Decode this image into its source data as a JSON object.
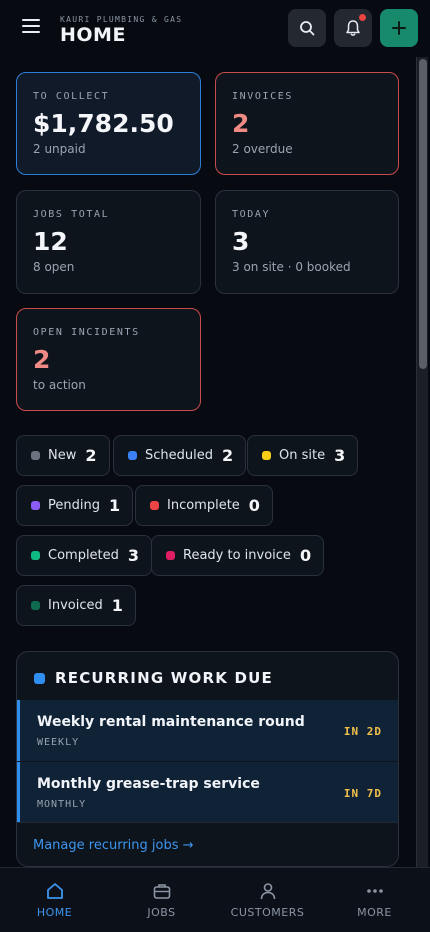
{
  "header": {
    "company": "KAURI PLUMBING & GAS",
    "title": "HOME"
  },
  "summary": {
    "to_collect": {
      "label": "TO COLLECT",
      "value": "$1,782.50",
      "sub": "2 unpaid"
    },
    "invoices": {
      "label": "INVOICES",
      "value": "2",
      "sub": "2 overdue"
    },
    "jobs_total": {
      "label": "JOBS TOTAL",
      "value": "12",
      "sub": "8 open"
    },
    "today": {
      "label": "TODAY",
      "value": "3",
      "sub": "3 on site · 0 booked"
    },
    "open_incidents": {
      "label": "OPEN INCIDENTS",
      "value": "2",
      "sub": "to action"
    }
  },
  "statuses": [
    {
      "label": "New",
      "count": "2",
      "color": "#6b7280"
    },
    {
      "label": "Scheduled",
      "count": "2",
      "color": "#3b82f6"
    },
    {
      "label": "On site",
      "count": "3",
      "color": "#facc15"
    },
    {
      "label": "Pending",
      "count": "1",
      "color": "#8b5cf6"
    },
    {
      "label": "Incomplete",
      "count": "0",
      "color": "#ef4444"
    },
    {
      "label": "Completed",
      "count": "3",
      "color": "#10b981"
    },
    {
      "label": "Ready to invoice",
      "count": "0",
      "color": "#e11d63"
    },
    {
      "label": "Invoiced",
      "count": "1",
      "color": "#0f6b4f"
    }
  ],
  "recurring": {
    "title": "RECURRING WORK DUE",
    "items": [
      {
        "name": "Weekly rental maintenance round",
        "frequency": "WEEKLY",
        "due": "IN 2D"
      },
      {
        "name": "Monthly grease-trap service",
        "frequency": "MONTHLY",
        "due": "IN 7D"
      }
    ],
    "manage_link": "Manage recurring jobs →"
  },
  "nav": [
    {
      "label": "HOME",
      "icon": "home-icon",
      "active": true
    },
    {
      "label": "JOBS",
      "icon": "briefcase-icon",
      "active": false
    },
    {
      "label": "CUSTOMERS",
      "icon": "user-icon",
      "active": false
    },
    {
      "label": "MORE",
      "icon": "more-icon",
      "active": false
    }
  ],
  "colors": {
    "accent": "#2f8ff0",
    "add_button": "#178a6c",
    "alert": "#c94b4b",
    "due": "#f2c04a"
  }
}
